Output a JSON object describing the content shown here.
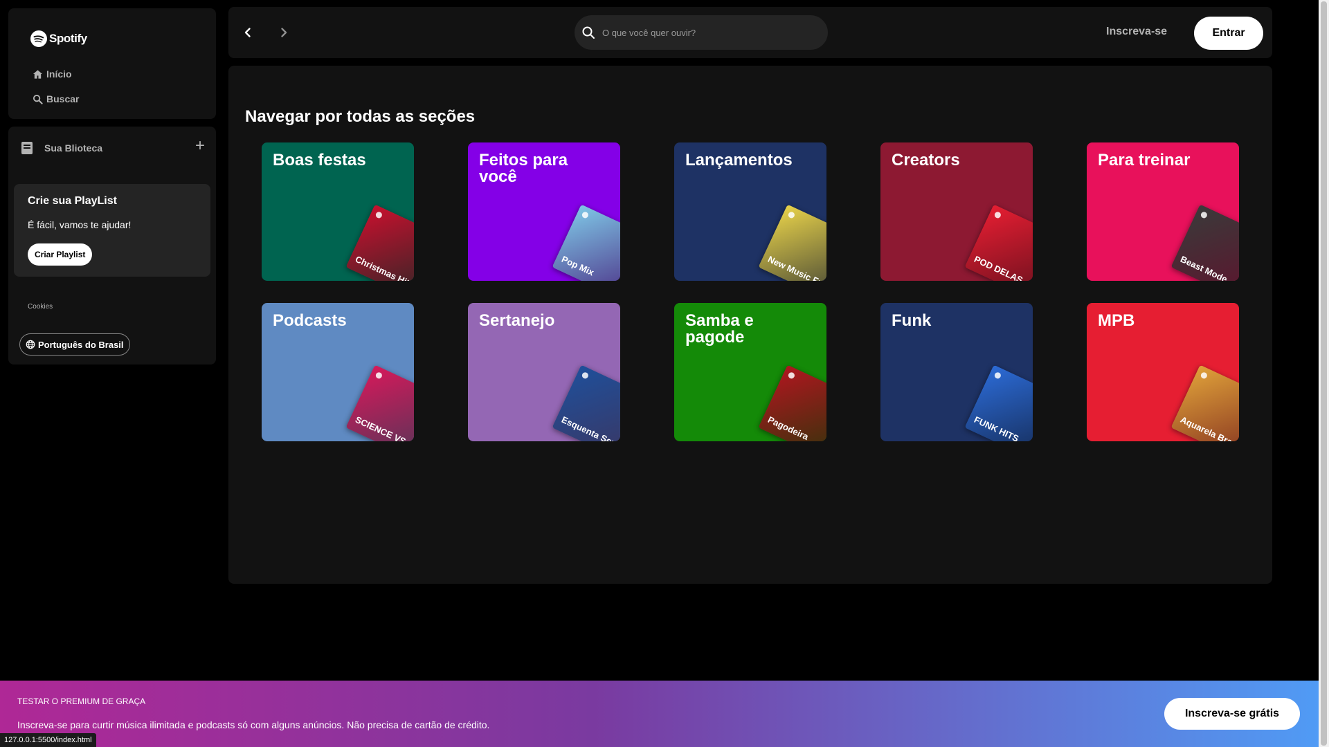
{
  "sidebar": {
    "logo_text": "Spotify",
    "nav": [
      {
        "label": "Início",
        "icon": "home-icon"
      },
      {
        "label": "Buscar",
        "icon": "search-icon"
      }
    ],
    "library": {
      "title": "Sua Blioteca",
      "add_icon": "plus-icon",
      "card": {
        "title": "Crie sua PlayList",
        "subtitle": "É fácil, vamos te ajudar!",
        "button": "Criar Playlist"
      },
      "cookies": "Cookies",
      "language": "Português do Brasil"
    }
  },
  "topbar": {
    "back_icon": "chevron-left-icon",
    "forward_icon": "chevron-right-icon",
    "search_placeholder": "O que você quer ouvir?",
    "signup": "Inscreva-se",
    "login": "Entrar"
  },
  "main": {
    "title": "Navegar por todas as seções",
    "categories": [
      {
        "title": "Boas festas",
        "color": "#006450",
        "art_label": "Christmas Hits",
        "art_color": "#c8102e"
      },
      {
        "title": "Feitos para você",
        "color": "#8400e7",
        "art_label": "Pop Mix",
        "art_color": "#7fc7e6"
      },
      {
        "title": "Lançamentos",
        "color": "#1e3264",
        "art_label": "New Music Friday",
        "art_color": "#e8d24a"
      },
      {
        "title": "Creators",
        "color": "#8d1932",
        "art_label": "POD DELAS",
        "art_color": "#e61e32"
      },
      {
        "title": "Para treinar",
        "color": "#e8115b",
        "art_label": "Beast Mode",
        "art_color": "#3a3a3a"
      },
      {
        "title": "Podcasts",
        "color": "#5f8ac2",
        "art_label": "SCIENCE VS",
        "art_color": "#d6195a"
      },
      {
        "title": "Sertanejo",
        "color": "#9467b4",
        "art_label": "Esquenta Sertanejo",
        "art_color": "#1f4f9a"
      },
      {
        "title": "Samba e pagode",
        "color": "#148a08",
        "art_label": "Pagodeira",
        "art_color": "#b0161f"
      },
      {
        "title": "Funk",
        "color": "#1e3264",
        "art_label": "FUNK HITS",
        "art_color": "#2c6bd6"
      },
      {
        "title": "MPB",
        "color": "#e61e32",
        "art_label": "Aquarela Brasileira",
        "art_color": "#e0a23a"
      }
    ]
  },
  "banner": {
    "title": "TESTAR O PREMIUM DE GRAÇA",
    "subtitle": "Inscreva-se para curtir música ilimitada e podcasts só com alguns anúncios. Não precisa de cartão de crédito.",
    "button": "Inscreva-se grátis"
  },
  "status_url": "127.0.0.1:5500/index.html"
}
